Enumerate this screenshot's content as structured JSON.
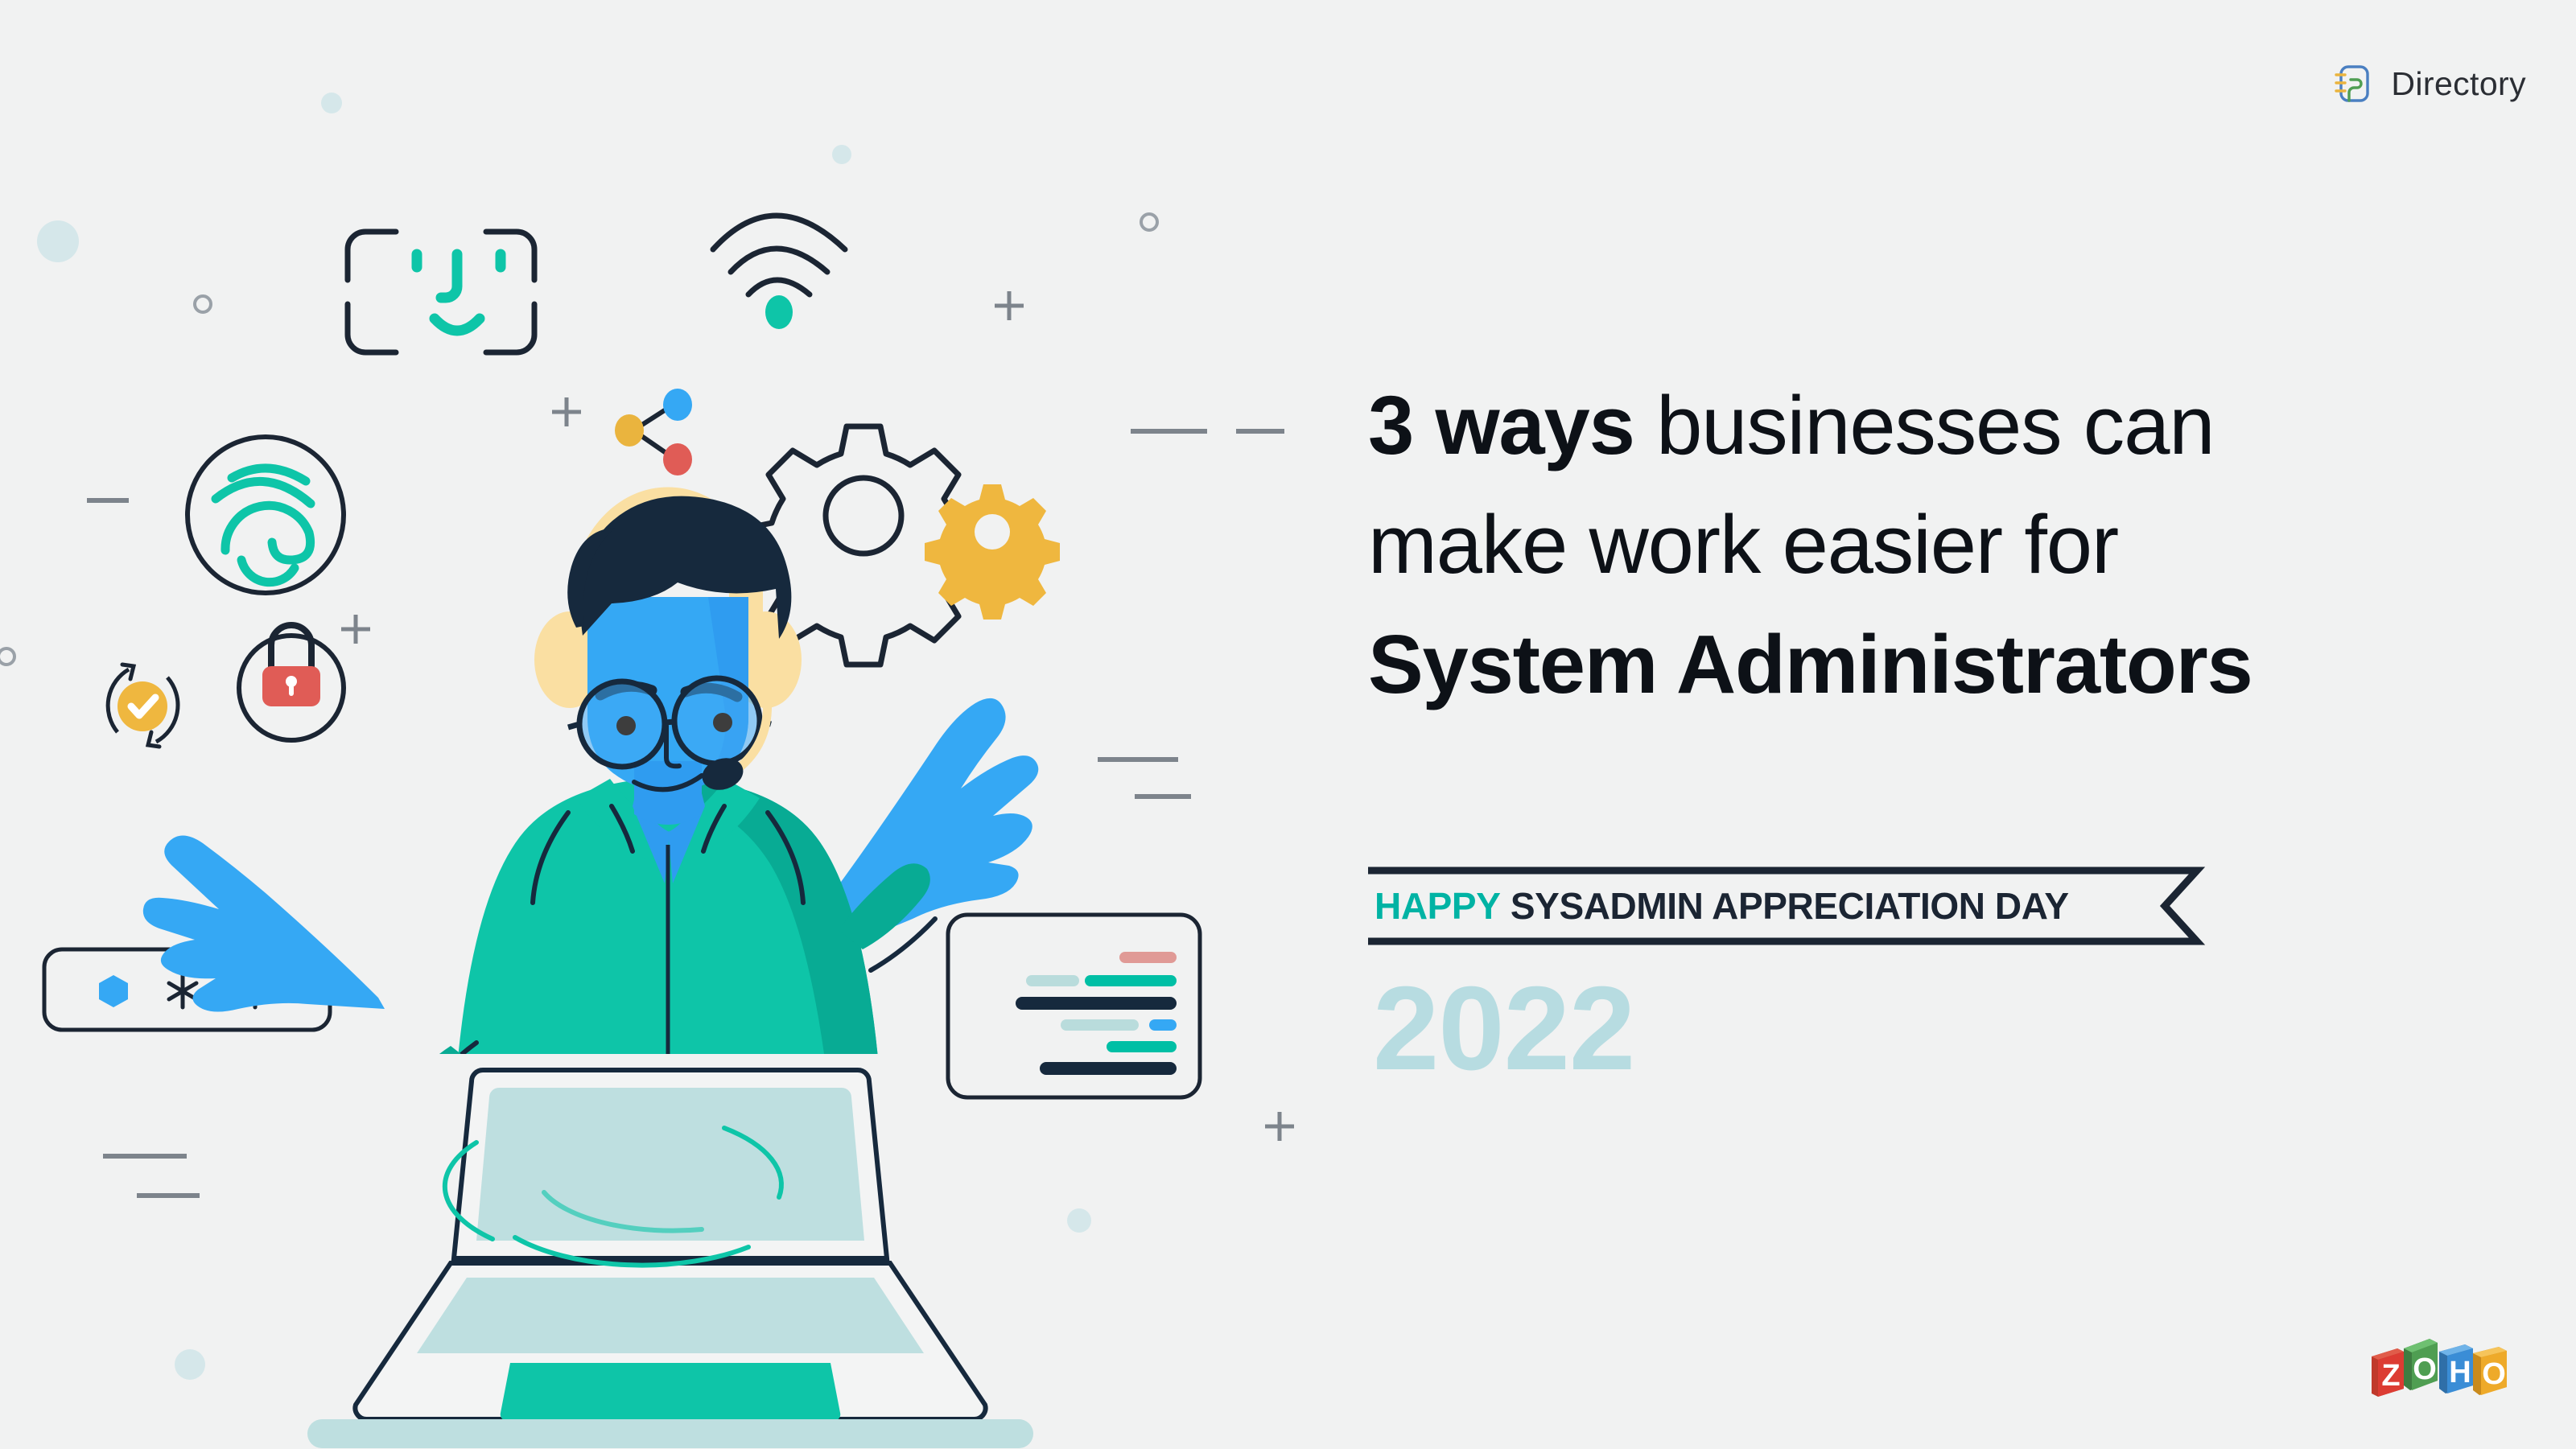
{
  "background_color": "#f1f2f2",
  "brand": {
    "name": "Directory",
    "logo_icon": "directory-notebook-icon",
    "logo_colors": {
      "frame": "#4a7fc1",
      "inner": "#4f9e52",
      "rings": "#eab43e"
    }
  },
  "headline": {
    "line1_bold": "3 ways",
    "line1_rest": " businesses can",
    "line2": "make work easier for",
    "line3_bold": "System Administrators",
    "color": "#0d1117"
  },
  "ribbon": {
    "highlight_text": "HAPPY",
    "highlight_color": "#00b3a4",
    "text": "SYSADMIN APPRECIATION DAY",
    "text_color": "#1b2533",
    "border_color": "#1b2533"
  },
  "year": {
    "value": "2022",
    "color": "#b7dce1"
  },
  "footer_logo": {
    "name": "ZOHO",
    "letters": [
      "Z",
      "O",
      "H",
      "O"
    ],
    "colors": [
      "#dc3c33",
      "#4f9e52",
      "#3a8dd6",
      "#eeaa2a"
    ]
  },
  "illustration": {
    "name": "sysadmin-emerging-from-laptop",
    "character": {
      "skin_color": "#35a8f4",
      "hair_color": "#16293d",
      "shirt_color": "#0ec5a8",
      "headset_color": "#fadfa2",
      "glasses_color": "#16293d",
      "mic_color": "#16293d"
    },
    "laptop": {
      "outline_color": "#16293d",
      "screen_fill": "#bedfe0",
      "trackpad_color": "#0ec5a8",
      "base_fill": "#f3f4f4"
    },
    "floating_icons": [
      {
        "name": "face-id-icon",
        "frame_color": "#1b2533",
        "face_color": "#0ec5a8"
      },
      {
        "name": "wifi-icon",
        "arc_color": "#1b2533",
        "dot_color": "#0ec5a8"
      },
      {
        "name": "share-nodes-icon",
        "node_colors": [
          "#eab43e",
          "#35a8f4",
          "#e05c56"
        ],
        "link_color": "#1b2533"
      },
      {
        "name": "gear-outline-icon",
        "color": "#1b2533"
      },
      {
        "name": "gear-solid-icon",
        "color": "#efb73f"
      },
      {
        "name": "fingerprint-icon",
        "circle_color": "#1b2533",
        "print_color": "#0ec5a8"
      },
      {
        "name": "padlock-icon",
        "circle_color": "#1b2533",
        "body_color": "#e05c56"
      },
      {
        "name": "sync-check-icon",
        "arrow_color": "#1b2533",
        "badge_color": "#efb73f"
      },
      {
        "name": "password-field-card",
        "border_color": "#1b2533",
        "hex_color": "#35a8f4",
        "asterisk_color": "#1b2533"
      },
      {
        "name": "code-snippet-card",
        "border_color": "#1b2533",
        "bar_colors": [
          "#e09a96",
          "#b9dcdc",
          "#00bfa5",
          "#16293d",
          "#35a8f4"
        ]
      }
    ],
    "decorations": {
      "dot_color": "#d5e7ea",
      "ring_color": "#9aa1a8",
      "dash_color": "#7d848c",
      "plus_color": "#7d848c"
    }
  }
}
